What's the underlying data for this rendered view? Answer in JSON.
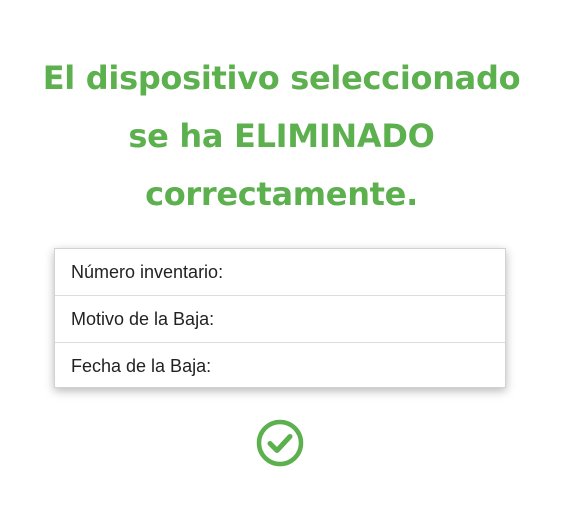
{
  "message": {
    "line1": "El dispositivo seleccionado",
    "line2": "se ha ELIMINADO",
    "line3": "correctamente."
  },
  "details": {
    "rows": [
      {
        "label": "Número inventario:"
      },
      {
        "label": "Motivo de la Baja:"
      },
      {
        "label": "Fecha de la Baja:"
      }
    ]
  },
  "colors": {
    "success": "#5cb04d",
    "text": "#222222"
  },
  "icons": {
    "status": "check-circle-icon"
  }
}
